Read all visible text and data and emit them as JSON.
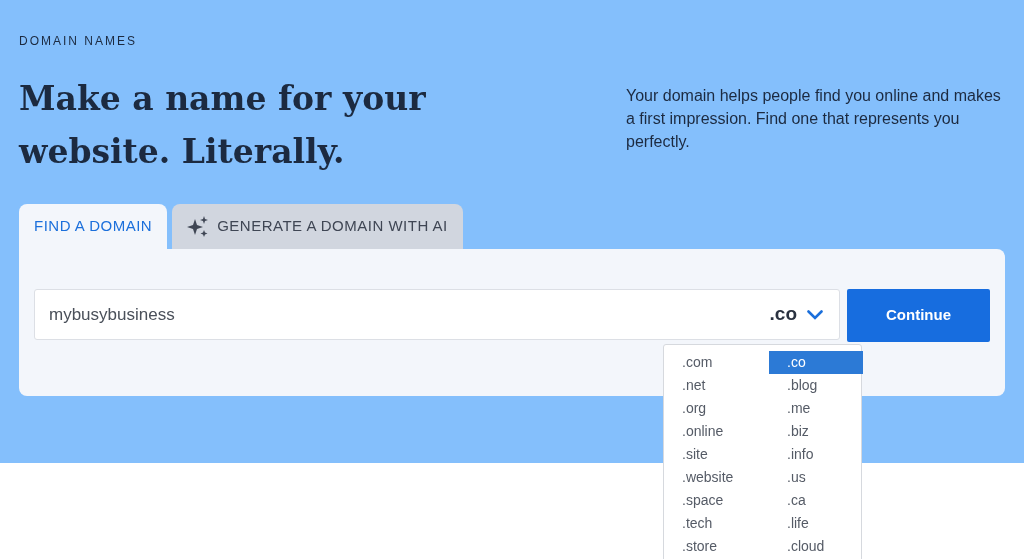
{
  "eyebrow": "DOMAIN NAMES",
  "heading": "Make a name for your website. Literally.",
  "intro": "Your domain helps people find you online and makes a first impression. Find one that represents you perfectly.",
  "tabs": [
    {
      "label": "FIND A DOMAIN",
      "selected": true,
      "kind": "plain"
    },
    {
      "label": "GENERATE A DOMAIN WITH AI",
      "selected": false,
      "kind": "ai"
    }
  ],
  "search": {
    "value": "mybusybusiness",
    "extension": ".co",
    "expanded": true
  },
  "continue_button": "Continue",
  "extensions": [
    {
      "label": ".com",
      "selected": false
    },
    {
      "label": ".net",
      "selected": false
    },
    {
      "label": ".org",
      "selected": false
    },
    {
      "label": ".online",
      "selected": false
    },
    {
      "label": ".site",
      "selected": false
    },
    {
      "label": ".website",
      "selected": false
    },
    {
      "label": ".space",
      "selected": false
    },
    {
      "label": ".tech",
      "selected": false
    },
    {
      "label": ".store",
      "selected": false
    },
    {
      "label": ".co",
      "selected": true
    },
    {
      "label": ".blog",
      "selected": false
    },
    {
      "label": ".me",
      "selected": false
    },
    {
      "label": ".biz",
      "selected": false
    },
    {
      "label": ".info",
      "selected": false
    },
    {
      "label": ".us",
      "selected": false
    },
    {
      "label": ".ca",
      "selected": false
    },
    {
      "label": ".life",
      "selected": false
    },
    {
      "label": ".cloud",
      "selected": false
    }
  ]
}
